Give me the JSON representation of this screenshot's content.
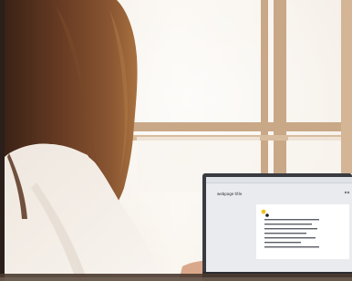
{
  "photo": {
    "subject": "woman-using-laptop-by-window",
    "colors": {
      "window_light": "#f7f2ea",
      "window_frame": "#c9a887",
      "hair": "#5a3420",
      "sweater": "#f2ece6",
      "laptop_body": "#3a3b40",
      "laptop_screen": "#e9ebee",
      "dialog": "#ffffff",
      "accent_dot": "#f2c21b"
    }
  },
  "laptop": {
    "screen_title": "webpage title"
  }
}
